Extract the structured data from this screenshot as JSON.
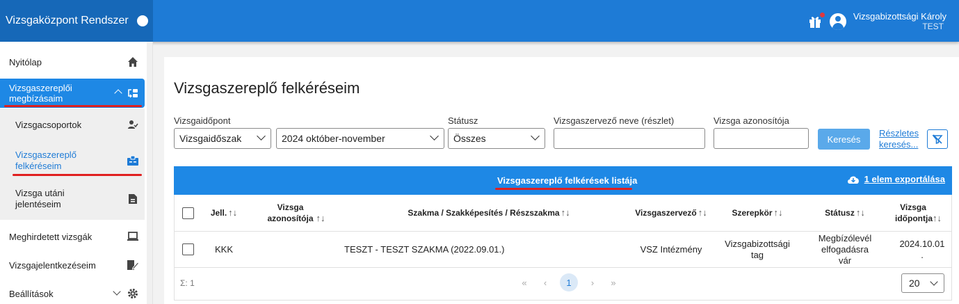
{
  "app": {
    "title": "Vizsgaközpont Rendszer",
    "user_name": "Vizsgabizottsági Károly",
    "user_env": "TEST"
  },
  "sidebar": {
    "items": [
      {
        "label": "Nyitólap",
        "icon": "home-icon"
      },
      {
        "label": "Vizsgaszereplői megbízásaim",
        "icon": "assignment-swap-icon",
        "active": true,
        "expanded": true
      },
      {
        "label": "Meghirdetett vizsgák",
        "icon": "laptop-icon"
      },
      {
        "label": "Vizsgajelentkezéseim",
        "icon": "edit-document-icon"
      },
      {
        "label": "Beállítások",
        "icon": "gear-icon"
      }
    ],
    "subitems": [
      {
        "label": "Vizsgacsoportok",
        "icon": "person-check-icon"
      },
      {
        "label": "Vizsgaszereplő felkéréseim",
        "icon": "badge-icon",
        "selected": true
      },
      {
        "label": "Vizsga utáni jelentéseim",
        "icon": "report-icon"
      }
    ]
  },
  "page": {
    "title": "Vizsgaszereplő felkéréseim"
  },
  "filters": {
    "exam_date_label": "Vizsgaidőpont",
    "exam_date_type": "Vizsgaidőszak",
    "exam_period": "2024 október-november",
    "status_label": "Státusz",
    "status_value": "Összes",
    "organizer_label": "Vizsgaszervező neve (részlet)",
    "organizer_value": "",
    "exam_id_label": "Vizsga azonosítója",
    "exam_id_value": "",
    "search_button": "Keresés",
    "advanced_search": "Részletes keresés..."
  },
  "table": {
    "title": "Vizsgaszereplő felkérések listája",
    "export": "1 elem exportálása",
    "columns": [
      "Jell.",
      "Vizsga azonosítója",
      "Szakma / Szakképesítés / Részszakma",
      "Vizsgaszervező",
      "Szerepkör",
      "Státusz",
      "Vizsga időpontja"
    ],
    "rows": [
      {
        "jell": "KKK",
        "exam_id": "",
        "profession": "TESZT - TESZT SZAKMA (2022.09.01.)",
        "organizer": "VSZ Intézmény",
        "role": "Vizsgabizottsági tag",
        "status": "Megbízólevél elfogadásra vár",
        "date": "2024.10.01 ."
      }
    ],
    "sum_label": "Σ: 1",
    "current_page": "1",
    "page_size": "20"
  },
  "colors": {
    "topbar": "#1e7bd6",
    "brand": "#1668b8",
    "active": "#1e88e5",
    "highlight_underline": "#e02020"
  }
}
